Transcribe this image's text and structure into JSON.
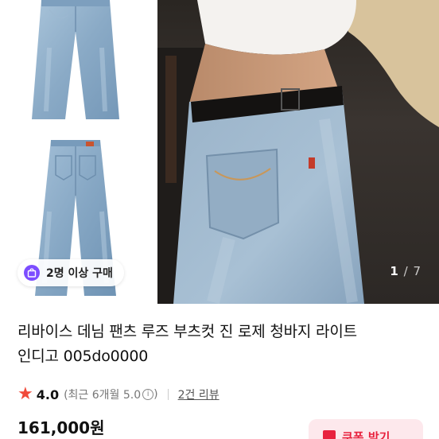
{
  "carousel": {
    "badge_text": "2명 이상 구매",
    "page_current": "1",
    "page_separator": "/",
    "page_total": "7"
  },
  "product": {
    "title_line1": "리바이스 데님 팬츠 루즈 부츠컷 진 로제 청바지 라이트",
    "title_line2": "인디고 005do0000",
    "rating": "4.0",
    "rating_note": "(최근 6개월 5.0",
    "rating_note_close": ")",
    "review_count_label": "2건 리뷰",
    "price": "161,000원",
    "coupon_label": "쿠폰 받기"
  },
  "colors": {
    "accent_red": "#e8223e",
    "star": "#f04a3a",
    "badge_purple": "#7c4dff",
    "denim": "#8fb0cc"
  }
}
